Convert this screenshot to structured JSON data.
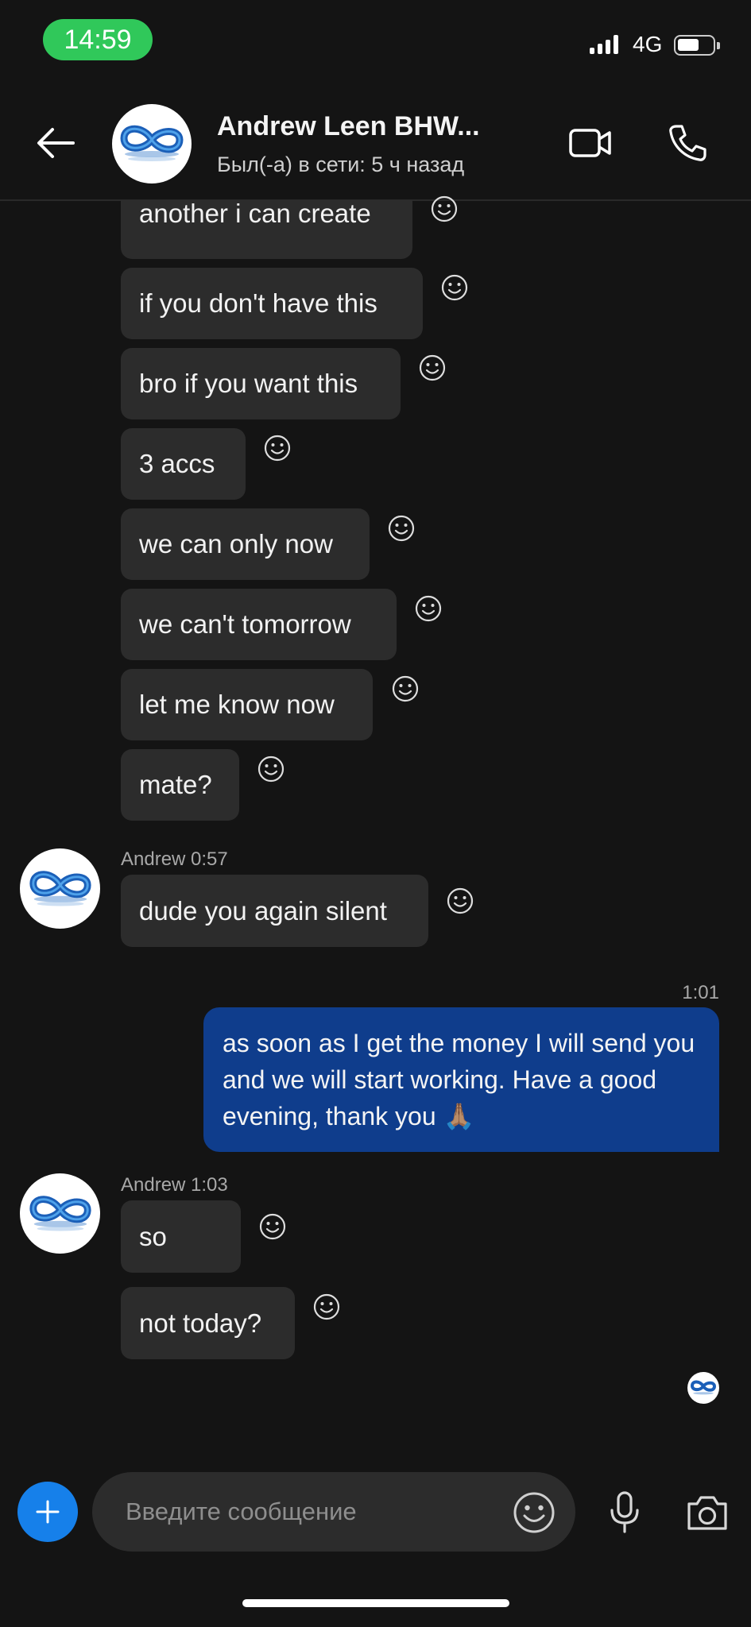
{
  "status_bar": {
    "time": "14:59",
    "network": "4G"
  },
  "header": {
    "contact_name": "Andrew Leen BHW...",
    "last_seen": "Был(-а) в сети: 5 ч назад"
  },
  "messages": [
    {
      "text": "another i can create"
    },
    {
      "text": "if you don't have this"
    },
    {
      "text": "bro if you want this"
    },
    {
      "text": "3 accs"
    },
    {
      "text": "we can only now"
    },
    {
      "text": "we can't tomorrow"
    },
    {
      "text": "let me know now"
    },
    {
      "text": "mate?"
    },
    {
      "text": "dude you again silent"
    },
    {
      "text": "so"
    },
    {
      "text": "not today?"
    }
  ],
  "groups": [
    {
      "sender_time": "Andrew 0:57"
    },
    {
      "sender_time": "Andrew 1:03"
    }
  ],
  "outgoing": {
    "time": "1:01",
    "text": "as soon as I get the money I will send you and we will start working. Have a good evening, thank you 🙏🏽"
  },
  "composer": {
    "placeholder": "Введите сообщение"
  },
  "colors": {
    "accent": "#1680ea",
    "outgoing_bubble": "#0f3d8c",
    "status_pill": "#30c85a"
  }
}
